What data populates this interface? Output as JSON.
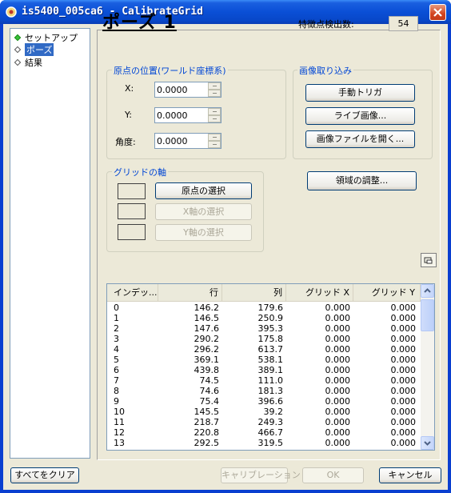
{
  "window": {
    "title": "is5400_005ca6 - CalibrateGrid"
  },
  "tree": {
    "items": [
      "セットアップ",
      "ポーズ",
      "結果"
    ]
  },
  "page": {
    "title": "ポーズ 1",
    "feature_count_label": "特徴点検出数:",
    "feature_count_value": "54"
  },
  "origin": {
    "legend": "原点の位置(ワールド座標系)",
    "x_label": "X:",
    "x_value": "0.0000",
    "y_label": "Y:",
    "y_value": "0.0000",
    "angle_label": "角度:",
    "angle_value": "0.0000"
  },
  "capture": {
    "legend": "画像取り込み",
    "manual_trigger": "手動トリガ",
    "live_image": "ライブ画像...",
    "open_file": "画像ファイルを開く..."
  },
  "grid_axis": {
    "legend": "グリッドの軸",
    "select_origin": "原点の選択",
    "select_x": "X軸の選択",
    "select_y": "Y軸の選択"
  },
  "adjust_region": "領域の調整...",
  "table": {
    "headers": [
      "インデッ...",
      "行",
      "列",
      "グリッド X",
      "グリッド Y"
    ],
    "rows": [
      [
        "0",
        "146.2",
        "179.6",
        "0.000",
        "0.000"
      ],
      [
        "1",
        "146.5",
        "250.9",
        "0.000",
        "0.000"
      ],
      [
        "2",
        "147.6",
        "395.3",
        "0.000",
        "0.000"
      ],
      [
        "3",
        "290.2",
        "175.8",
        "0.000",
        "0.000"
      ],
      [
        "4",
        "296.2",
        "613.7",
        "0.000",
        "0.000"
      ],
      [
        "5",
        "369.1",
        "538.1",
        "0.000",
        "0.000"
      ],
      [
        "6",
        "439.8",
        "389.1",
        "0.000",
        "0.000"
      ],
      [
        "7",
        "74.5",
        "111.0",
        "0.000",
        "0.000"
      ],
      [
        "8",
        "74.6",
        "181.3",
        "0.000",
        "0.000"
      ],
      [
        "9",
        "75.4",
        "396.6",
        "0.000",
        "0.000"
      ],
      [
        "10",
        "145.5",
        "39.2",
        "0.000",
        "0.000"
      ],
      [
        "11",
        "218.7",
        "249.3",
        "0.000",
        "0.000"
      ],
      [
        "12",
        "220.8",
        "466.7",
        "0.000",
        "0.000"
      ],
      [
        "13",
        "292.5",
        "319.5",
        "0.000",
        "0.000"
      ]
    ]
  },
  "footer": {
    "clear_all": "すべてをクリア",
    "calibration": "キャリブレーション",
    "ok": "OK",
    "cancel": "キャンセル"
  },
  "colors": {
    "title_bar": "#0a4fd6",
    "face": "#ece9d8",
    "group_label": "#0046d5",
    "selection": "#316ac5"
  }
}
